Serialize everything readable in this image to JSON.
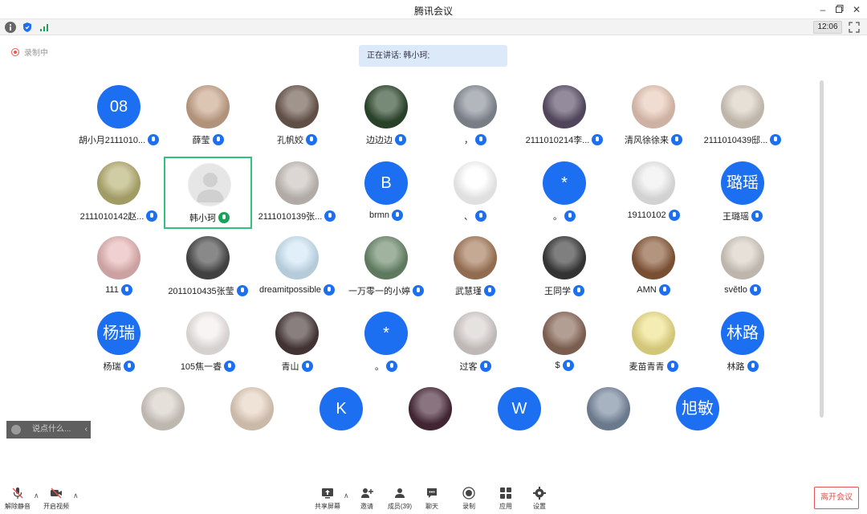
{
  "window": {
    "title": "腾讯会议"
  },
  "status": {
    "clock": "12:06"
  },
  "recording": {
    "label": "录制中"
  },
  "speaking": {
    "label": "正在讲话: 韩小珂;"
  },
  "participants": [
    {
      "name": "胡小月2111010...",
      "avatar_text": "08",
      "avatar_color": "#1d6ff2"
    },
    {
      "name": "薛莹",
      "avatar_text": "",
      "avatar_color": "#c9a68b"
    },
    {
      "name": "孔帆姣",
      "avatar_text": "",
      "avatar_color": "#6d5a4f"
    },
    {
      "name": "边边边",
      "avatar_text": "",
      "avatar_color": "#2e4a2e"
    },
    {
      "name": "，",
      "avatar_text": "",
      "avatar_color": "#8a8f99"
    },
    {
      "name": "2111010214李...",
      "avatar_text": "",
      "avatar_color": "#5b4f68"
    },
    {
      "name": "清风徐徐来",
      "avatar_text": "",
      "avatar_color": "#e9c9b8"
    },
    {
      "name": "2111010439邸...",
      "avatar_text": "",
      "avatar_color": "#d9cfc2"
    },
    {
      "name": "2111010142赵...",
      "avatar_text": "",
      "avatar_color": "#b7b073"
    },
    {
      "name": "韩小珂",
      "avatar_text": "",
      "avatar_color": "#e6e6e6"
    },
    {
      "name": "2111010139张...",
      "avatar_text": "",
      "avatar_color": "#c9c2bd"
    },
    {
      "name": "brmn",
      "avatar_text": "B",
      "avatar_color": "#1d6ff2"
    },
    {
      "name": "、",
      "avatar_text": "",
      "avatar_color": "#ffffff"
    },
    {
      "name": "。",
      "avatar_text": "*",
      "avatar_color": "#1d6ff2"
    },
    {
      "name": "19110102",
      "avatar_text": "",
      "avatar_color": "#efefef"
    },
    {
      "name": "王璐瑶",
      "avatar_text": "璐瑶",
      "avatar_color": "#1d6ff2"
    },
    {
      "name": "111",
      "avatar_text": "",
      "avatar_color": "#e8b7b7"
    },
    {
      "name": "2011010435张莹",
      "avatar_text": "",
      "avatar_color": "#4a4a4a"
    },
    {
      "name": "dreamitpossible",
      "avatar_text": "",
      "avatar_color": "#cfe7f7"
    },
    {
      "name": "一万零一的小婷",
      "avatar_text": "",
      "avatar_color": "#6c8a6c"
    },
    {
      "name": "武慧瑾",
      "avatar_text": "",
      "avatar_color": "#a67b5b"
    },
    {
      "name": "王同学",
      "avatar_text": "",
      "avatar_color": "#3a3a3a"
    },
    {
      "name": "AMN",
      "avatar_text": "",
      "avatar_color": "#8a5a3a"
    },
    {
      "name": "světlo",
      "avatar_text": "",
      "avatar_color": "#d8cfc4"
    },
    {
      "name": "杨瑞",
      "avatar_text": "杨瑞",
      "avatar_color": "#1d6ff2"
    },
    {
      "name": "105焦一睿",
      "avatar_text": "",
      "avatar_color": "#f4eeee"
    },
    {
      "name": "青山",
      "avatar_text": "",
      "avatar_color": "#4a3a3a"
    },
    {
      "name": "。",
      "avatar_text": "*",
      "avatar_color": "#1d6ff2"
    },
    {
      "name": "过客",
      "avatar_text": "",
      "avatar_color": "#d9d2d0"
    },
    {
      "name": "$",
      "avatar_text": "",
      "avatar_color": "#8a6a5a"
    },
    {
      "name": "麦苗青青",
      "avatar_text": "",
      "avatar_color": "#efe28a"
    },
    {
      "name": "林路",
      "avatar_text": "林路",
      "avatar_color": "#1d6ff2"
    },
    {
      "name": "",
      "avatar_text": "",
      "avatar_color": "#d8d0c8"
    },
    {
      "name": "",
      "avatar_text": "",
      "avatar_color": "#e6d2c0"
    },
    {
      "name": "",
      "avatar_text": "K",
      "avatar_color": "#1d6ff2"
    },
    {
      "name": "",
      "avatar_text": "",
      "avatar_color": "#4a2a3a"
    },
    {
      "name": "",
      "avatar_text": "W",
      "avatar_color": "#1d6ff2"
    },
    {
      "name": "",
      "avatar_text": "",
      "avatar_color": "#7a8aa0"
    },
    {
      "name": "",
      "avatar_text": "旭敏",
      "avatar_color": "#1d6ff2"
    }
  ],
  "chat": {
    "placeholder": "说点什么..."
  },
  "toolbar": {
    "mute": "解除静音",
    "video": "开启视频",
    "share": "共享屏幕",
    "invite": "邀请",
    "members": "成员(39)",
    "chat": "聊天",
    "record": "录制",
    "apps": "应用",
    "settings": "设置",
    "leave": "离开会议"
  }
}
